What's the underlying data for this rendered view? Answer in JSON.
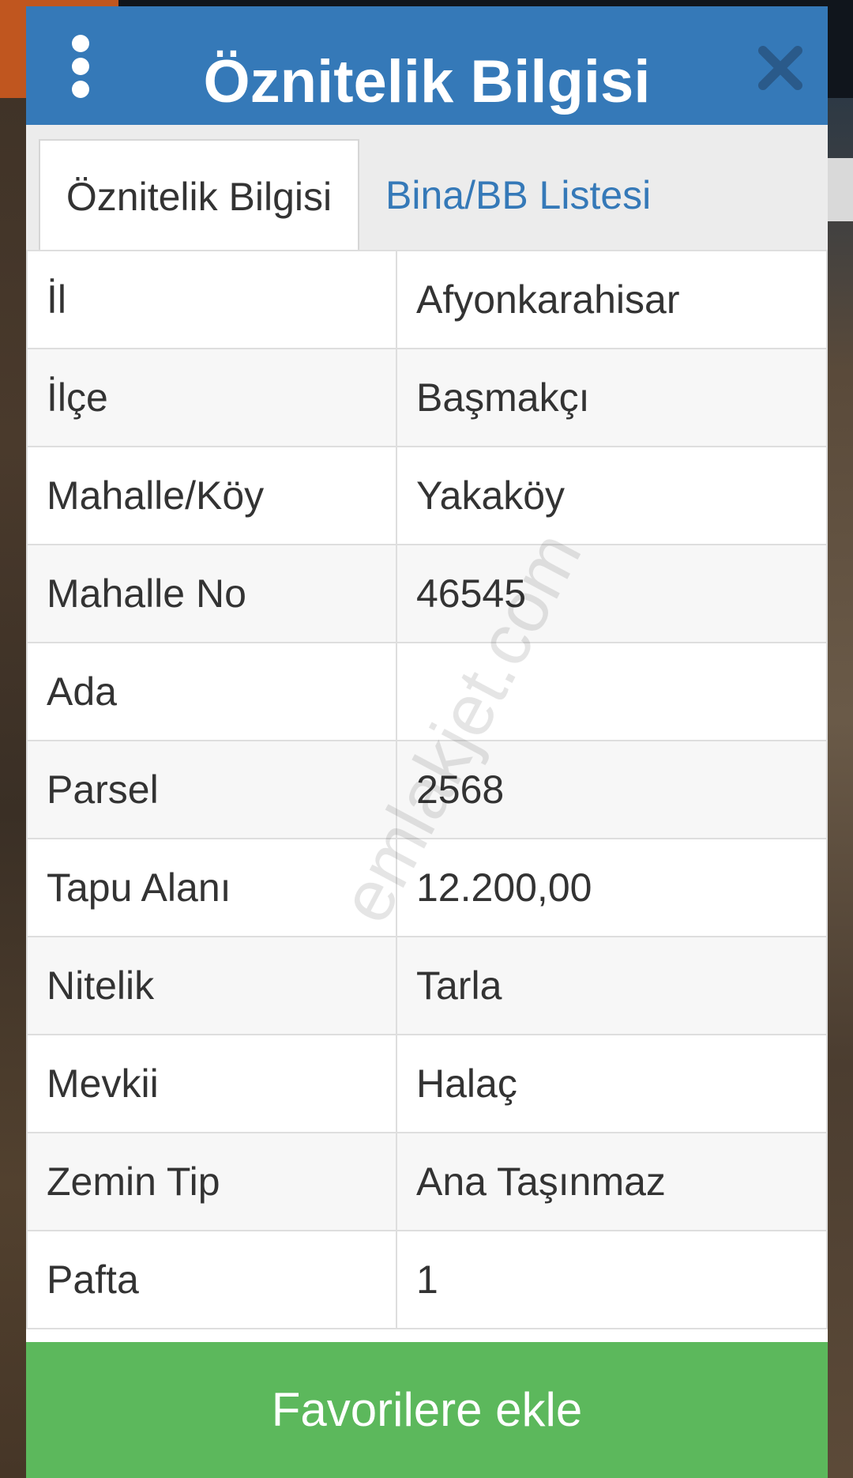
{
  "modal": {
    "title": "Öznitelik Bilgisi",
    "tabs": [
      {
        "label": "Öznitelik Bilgisi",
        "active": true
      },
      {
        "label": "Bina/BB Listesi",
        "active": false
      }
    ],
    "rows": [
      {
        "key": "İl",
        "value": "Afyonkarahisar"
      },
      {
        "key": "İlçe",
        "value": "Başmakçı"
      },
      {
        "key": "Mahalle/Köy",
        "value": "Yakaköy"
      },
      {
        "key": "Mahalle No",
        "value": "46545"
      },
      {
        "key": "Ada",
        "value": ""
      },
      {
        "key": "Parsel",
        "value": "2568"
      },
      {
        "key": "Tapu Alanı",
        "value": "12.200,00"
      },
      {
        "key": "Nitelik",
        "value": "Tarla"
      },
      {
        "key": "Mevkii",
        "value": "Halaç"
      },
      {
        "key": "Zemin Tip",
        "value": "Ana Taşınmaz"
      },
      {
        "key": "Pafta",
        "value": "1"
      }
    ],
    "favorite_button_label": "Favorilere ekle"
  },
  "watermark": "emlakjet.com",
  "icons": {
    "menu": "kebab-menu-icon",
    "close": "close-icon"
  },
  "colors": {
    "header": "#3579b8",
    "tab_link": "#3579b8",
    "favorite_button": "#5cb85c"
  }
}
